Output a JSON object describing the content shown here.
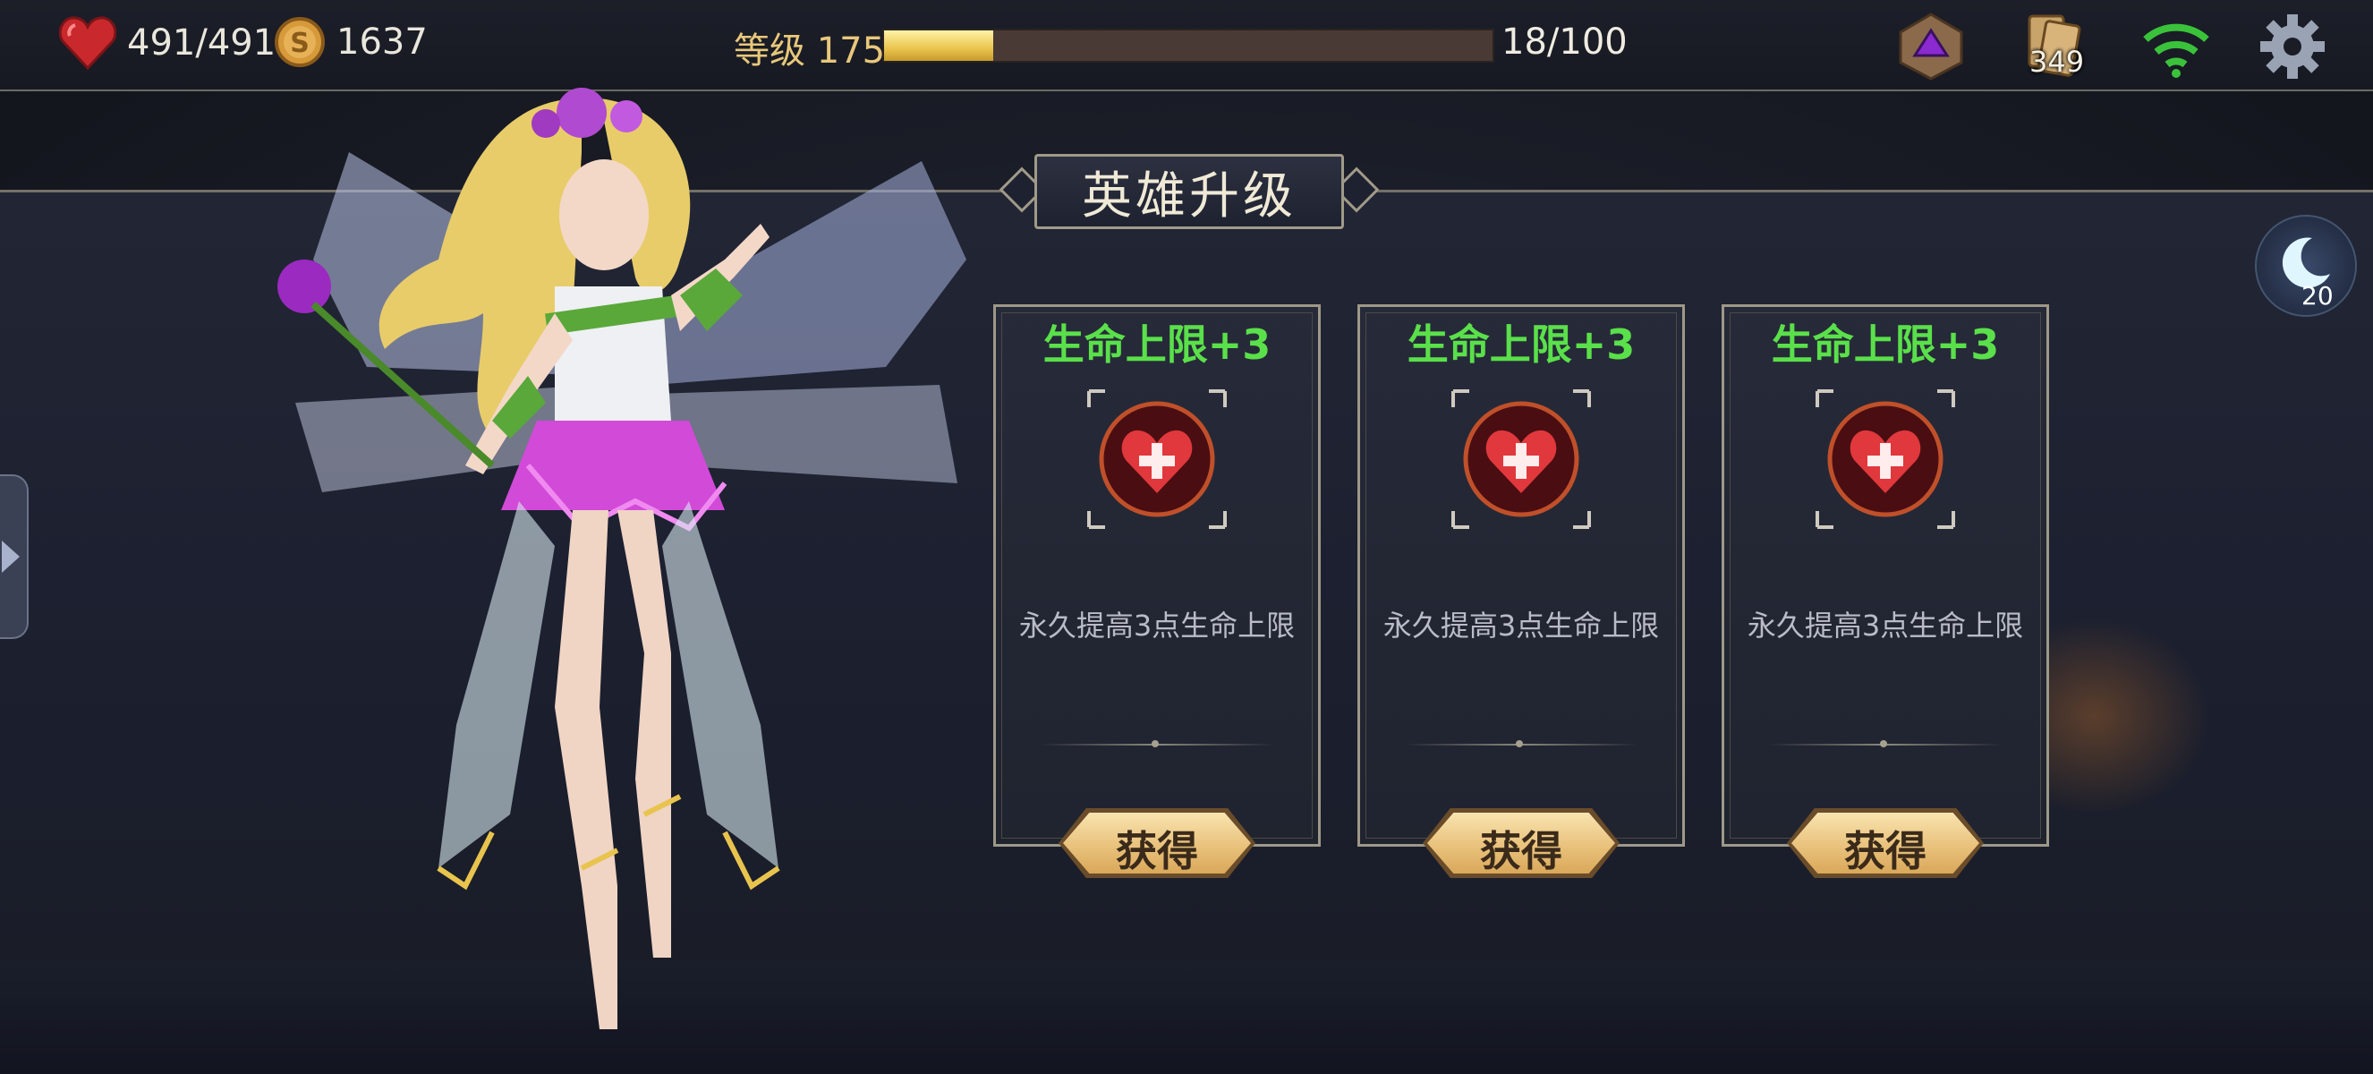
{
  "header": {
    "hp": "491/491",
    "gold": "1637",
    "level_label": "等级 175",
    "xp_text": "18/100",
    "xp_progress": 0.18,
    "cards_count": "349",
    "icons": [
      "heart-icon",
      "coin-icon",
      "dice-icon",
      "cards-icon",
      "wifi-icon",
      "gear-icon"
    ]
  },
  "panel": {
    "title": "英雄升级",
    "moon_count": "20"
  },
  "upgrades": [
    {
      "title": "生命上限+3",
      "description": "永久提高3点生命上限",
      "button": "获得",
      "icon": "heart-plus-icon"
    },
    {
      "title": "生命上限+3",
      "description": "永久提高3点生命上限",
      "button": "获得",
      "icon": "heart-plus-icon"
    },
    {
      "title": "生命上限+3",
      "description": "永久提高3点生命上限",
      "button": "获得",
      "icon": "heart-plus-icon"
    }
  ],
  "colors": {
    "accent_green": "#5ae04a",
    "gold_bar": "#e9c44e",
    "button_gold": "#e9c27c"
  }
}
